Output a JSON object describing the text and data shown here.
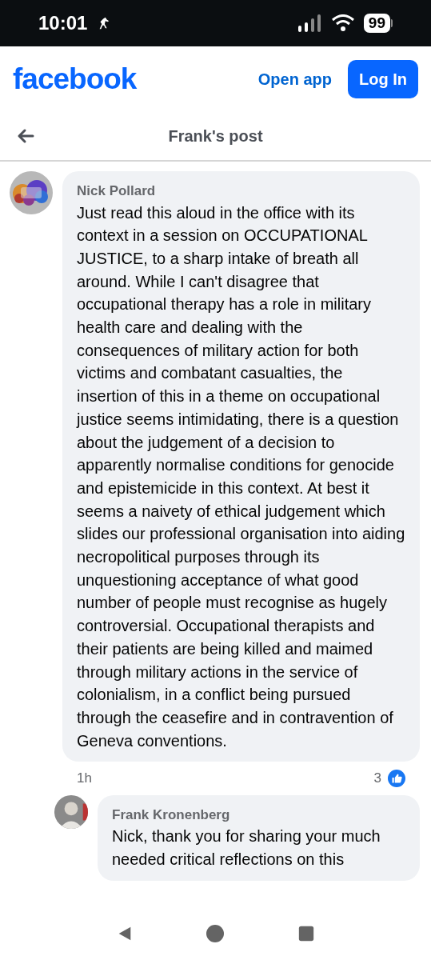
{
  "status_bar": {
    "time": "10:01",
    "battery": "99"
  },
  "header": {
    "logo": "facebook",
    "open_app": "Open app",
    "login": "Log In"
  },
  "title_bar": {
    "title": "Frank's post"
  },
  "comments": [
    {
      "author": "Nick Pollard",
      "text": "Just read this aloud in the office with its context in a session on OCCUPATIONAL JUSTICE, to a sharp intake of breath all around. While I can't disagree that occupational therapy has a role in military health care and dealing with the consequences of military action for both victims and combatant casualties, the insertion of this in a theme on occupational justice seems intimidating, there is a question about the judgement of a decision to apparently normalise conditions for genocide and epistemicide in this context. At best it seems a naivety of ethical judgement which slides our professional organisation into aiding necropolitical purposes through its unquestioning acceptance of what good number of people must recognise as hugely controversial. Occupational therapists and their patients are being killed and maimed through military actions in the service of colonialism, in a conflict being pursued through the ceasefire and in contravention of Geneva conventions.",
      "time": "1h",
      "likes": "3",
      "reply": false
    },
    {
      "author": "Frank Kronenberg",
      "text": "Nick, thank you for sharing your much needed critical reflections on this",
      "reply": true
    }
  ]
}
